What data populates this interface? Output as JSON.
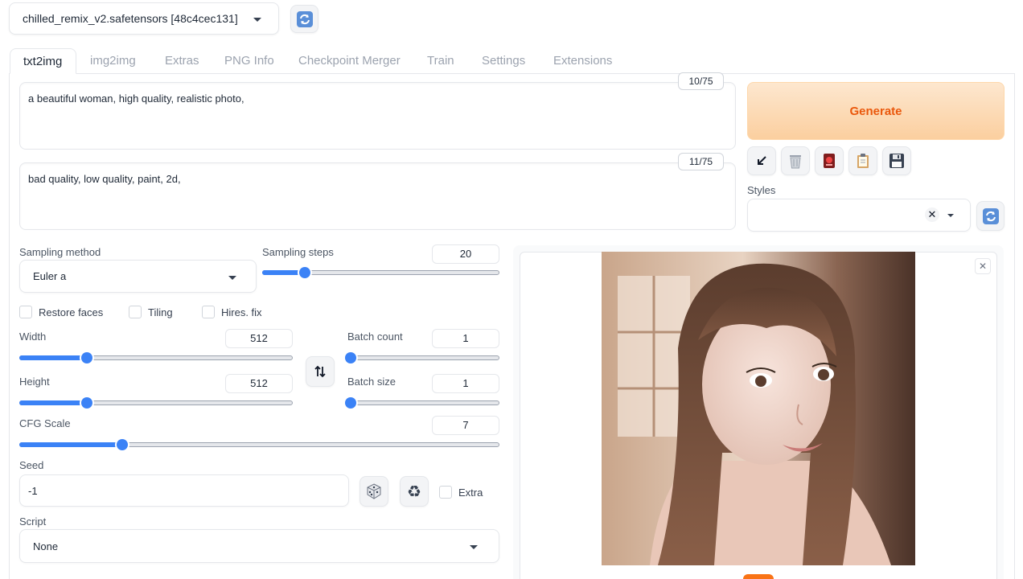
{
  "checkpoint": {
    "value": "chilled_remix_v2.safetensors [48c4cec131]"
  },
  "tabs": [
    {
      "label": "txt2img"
    },
    {
      "label": "img2img"
    },
    {
      "label": "Extras"
    },
    {
      "label": "PNG Info"
    },
    {
      "label": "Checkpoint Merger"
    },
    {
      "label": "Train"
    },
    {
      "label": "Settings"
    },
    {
      "label": "Extensions"
    }
  ],
  "prompt": {
    "text": "a beautiful woman, high quality, realistic photo,",
    "token_count": "10/75"
  },
  "negative_prompt": {
    "text": "bad quality, low quality, paint, 2d,",
    "token_count": "11/75"
  },
  "generate": {
    "label": "Generate"
  },
  "toolbar": {
    "icons": [
      "arrow-down-left-icon",
      "trash-icon",
      "card-icon",
      "clipboard-icon",
      "floppy-disk-icon"
    ]
  },
  "styles": {
    "label": "Styles",
    "value": ""
  },
  "sampling": {
    "method_label": "Sampling method",
    "method_value": "Euler a",
    "steps_label": "Sampling steps",
    "steps_value": "20",
    "steps_fraction": 0.17
  },
  "options": {
    "restore_faces": "Restore faces",
    "tiling": "Tiling",
    "hires_fix": "Hires. fix"
  },
  "width": {
    "label": "Width",
    "value": "512",
    "fraction": 0.24
  },
  "height": {
    "label": "Height",
    "value": "512",
    "fraction": 0.24
  },
  "batch_count": {
    "label": "Batch count",
    "value": "1",
    "fraction": 0.0
  },
  "batch_size": {
    "label": "Batch size",
    "value": "1",
    "fraction": 0.0
  },
  "cfg": {
    "label": "CFG Scale",
    "value": "7",
    "fraction": 0.21
  },
  "seed": {
    "label": "Seed",
    "value": "-1",
    "extra_label": "Extra"
  },
  "script": {
    "label": "Script",
    "value": "None"
  },
  "colors": {
    "accent": "#3b82f6",
    "generate_text": "#ea580c"
  }
}
